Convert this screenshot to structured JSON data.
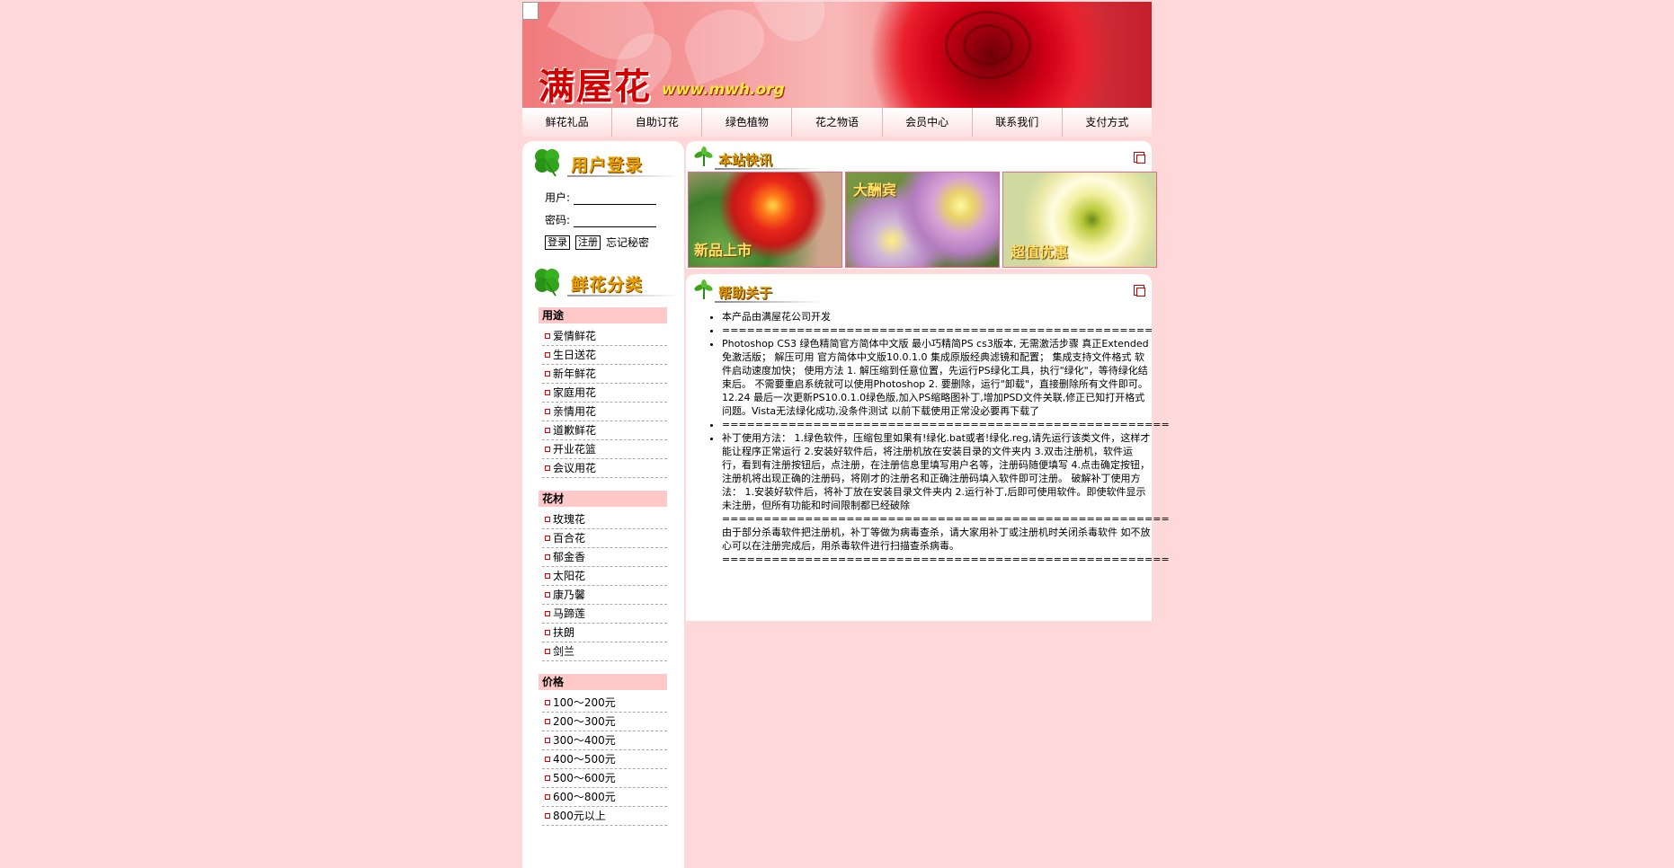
{
  "header": {
    "logo_text": "满屋花",
    "url_text": "www.mwh.org"
  },
  "nav": [
    "鲜花礼品",
    "自助订花",
    "绿色植物",
    "花之物语",
    "会员中心",
    "联系我们",
    "支付方式"
  ],
  "login": {
    "title": "用户登录",
    "user_label": "用户:",
    "pass_label": "密码:",
    "login_button": "登录",
    "register_button": "注册",
    "forgot_text": "忘记秘密"
  },
  "categories": {
    "title": "鲜花分类",
    "groups": [
      {
        "head": "用途",
        "items": [
          "爱情鲜花",
          "生日送花",
          "新年鲜花",
          "家庭用花",
          "亲情用花",
          "道歉鲜花",
          "开业花篮",
          "会议用花"
        ]
      },
      {
        "head": "花材",
        "items": [
          "玫瑰花",
          "百合花",
          "郁金香",
          "太阳花",
          "康乃馨",
          "马蹄莲",
          "扶朗",
          "剑兰"
        ]
      },
      {
        "head": "价格",
        "items": [
          "100～200元",
          "200～300元",
          "300～400元",
          "400～500元",
          "500～600元",
          "600～800元",
          "800元以上"
        ]
      }
    ]
  },
  "news": {
    "title": "本站快讯",
    "photos": [
      {
        "caption": "新品上市"
      },
      {
        "caption": "大酬宾"
      },
      {
        "caption": "超值优惠"
      }
    ]
  },
  "help": {
    "title": "帮助关于",
    "items": [
      "本产品由满屋花公司开发",
      "====================================================",
      "Photoshop CS3 绿色精简官方简体中文版 最小巧精简PS cs3版本, 无需激活步骤 真正Extended免激活版； 解压可用 官方简体中文版10.0.1.0 集成原版经典滤镜和配置； 集成支持文件格式 软件启动速度加快； 使用方法 1. 解压缩到任意位置，先运行PS绿化工具，执行\"绿化\"，等待绿化结束后。 不需要重启系统就可以使用Photoshop 2. 要删除，运行\"卸载\"，直接删除所有文件即可。 12.24 最后一次更新PS10.0.1.0绿色版,加入PS缩略图补丁,增加PSD文件关联,修正已知打开格式问题。Vista无法绿化成功,没条件测试 以前下载使用正常没必要再下载了",
      "======================================================",
      "补丁使用方法： 1.绿色软件，压缩包里如果有!绿化.bat或者!绿化.reg,请先运行该类文件，这样才能让程序正常运行 2.安装好软件后，将注册机放在安装目录的文件夹内 3.双击注册机，软件运行，看到有注册按钮后，点注册，在注册信息里填写用户名等，注册码随便填写 4.点击确定按钮，注册机将出现正确的注册码，将刚才的注册名和正确注册码填入软件即可注册。 破解补丁使用方法： 1.安装好软件后，将补丁放在安装目录文件夹内 2.运行补丁,后即可使用软件。即使软件显示未注册，但所有功能和时间限制都已经破除 ====================================================== 由于部分杀毒软件把注册机，补丁等做为病毒查杀，请大家用补丁或注册机时关闭杀毒软件 如不放心可以在注册完成后，用杀毒软件进行扫描查杀病毒。 ======================================================"
    ]
  }
}
